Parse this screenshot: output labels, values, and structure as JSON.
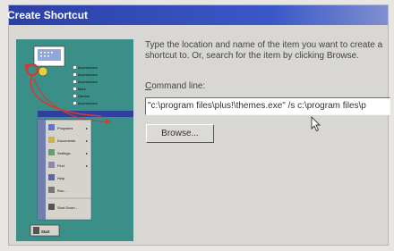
{
  "window": {
    "title": "Create Shortcut"
  },
  "wizard": {
    "instructions": "Type the location and name of the item you want to create a shortcut to. Or, search for the item by clicking Browse.",
    "command_line_label_prefix": "",
    "command_line_label_underlined": "C",
    "command_line_label_rest": "ommand line:",
    "command_line_value": "\"c:\\program files\\plus!\\themes.exe\" /s c:\\program files\\p",
    "browse_label": "Browse..."
  },
  "illustration": {
    "side_items": [
      "Accessories",
      "Accessories",
      "Accessories",
      "Marc",
      "Games",
      "Accessories"
    ],
    "menu_items": [
      "Programs",
      "Documents",
      "Settings",
      "Find",
      "Help",
      "Run...",
      "Shut Down..."
    ],
    "start_label": "Start"
  },
  "colors": {
    "titlebar": "#2c3fa6",
    "illustration_bg": "#3a8f88",
    "highlight": "#2e3f9e",
    "arrow": "#d23b32"
  }
}
